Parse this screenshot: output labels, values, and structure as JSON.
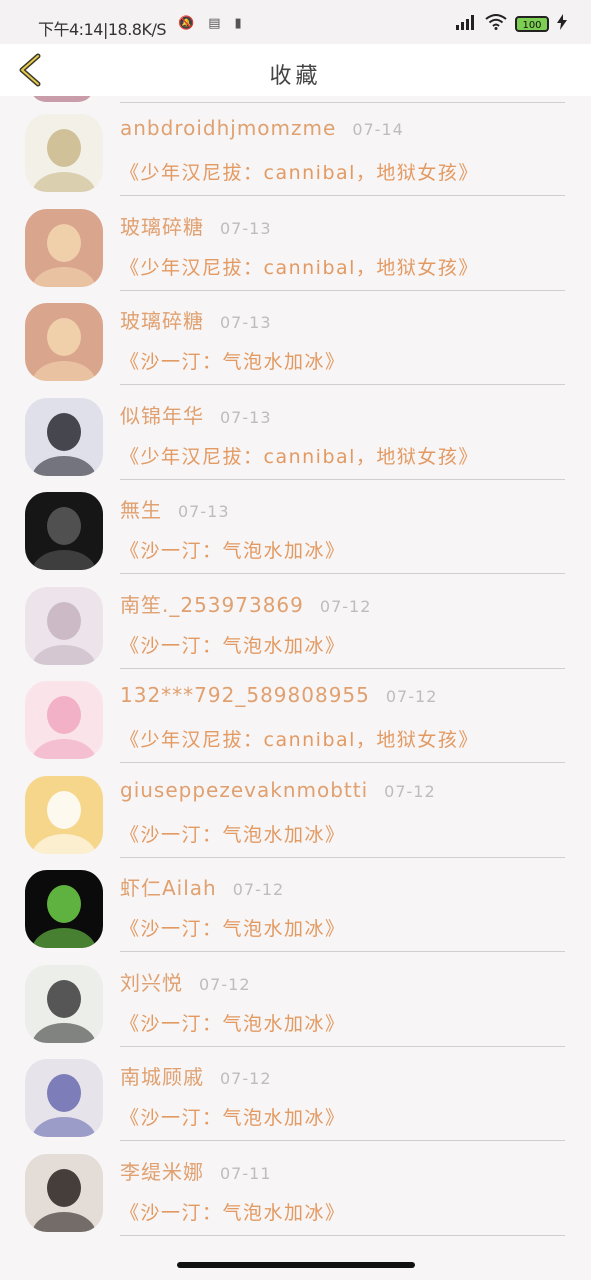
{
  "status_bar": {
    "time": "下午4:14",
    "speed": "18.8K/S",
    "battery": "100"
  },
  "header": {
    "title": "收藏"
  },
  "items": [
    {
      "user": "anbdroidhjmomzme",
      "date": "07-14",
      "song": "《少年汉尼拔：cannibal，地狱女孩》",
      "avatar_colors": [
        "#f3f1e7",
        "#c9b98a"
      ]
    },
    {
      "user": "玻璃碎糖",
      "date": "07-13",
      "song": "《少年汉尼拔：cannibal，地狱女孩》",
      "avatar_colors": [
        "#d9a58d",
        "#f3d6b0"
      ]
    },
    {
      "user": "玻璃碎糖",
      "date": "07-13",
      "song": "《沙一汀：气泡水加冰》",
      "avatar_colors": [
        "#d9a58d",
        "#f3d6b0"
      ]
    },
    {
      "user": "似锦年华",
      "date": "07-13",
      "song": "《少年汉尼拔：cannibal，地狱女孩》",
      "avatar_colors": [
        "#dfe0ea",
        "#2b2b33"
      ]
    },
    {
      "user": "無生",
      "date": "07-13",
      "song": "《沙一汀：气泡水加冰》",
      "avatar_colors": [
        "#161616",
        "#5a5a5a"
      ]
    },
    {
      "user": "南笙._253973869",
      "date": "07-12",
      "song": "《沙一汀：气泡水加冰》",
      "avatar_colors": [
        "#ece4ea",
        "#c7b4c0"
      ]
    },
    {
      "user": "132***792_589808955",
      "date": "07-12",
      "song": "《少年汉尼拔：cannibal，地狱女孩》",
      "avatar_colors": [
        "#fbe3ea",
        "#f0a8c0"
      ]
    },
    {
      "user": "giuseppezevaknmobtti",
      "date": "07-12",
      "song": "《沙一汀：气泡水加冰》",
      "avatar_colors": [
        "#f5d68a",
        "#ffffff"
      ]
    },
    {
      "user": "虾仁Ailah",
      "date": "07-12",
      "song": "《沙一汀：气泡水加冰》",
      "avatar_colors": [
        "#0b0b0b",
        "#6fcf4a"
      ]
    },
    {
      "user": "刘兴悦",
      "date": "07-12",
      "song": "《沙一汀：气泡水加冰》",
      "avatar_colors": [
        "#ecefe9",
        "#3b3b3b"
      ]
    },
    {
      "user": "南城顾戚",
      "date": "07-12",
      "song": "《沙一汀：气泡水加冰》",
      "avatar_colors": [
        "#e7e3ea",
        "#6a6cb0"
      ]
    },
    {
      "user": "李缇米娜",
      "date": "07-11",
      "song": "《沙一汀：气泡水加冰》",
      "avatar_colors": [
        "#e4dcd6",
        "#2a2220"
      ]
    }
  ]
}
